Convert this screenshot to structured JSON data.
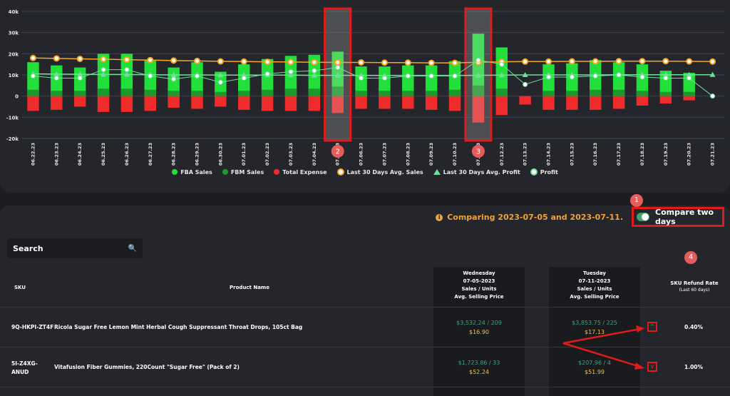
{
  "chart_data": {
    "type": "bar",
    "categories": [
      "06.22.23",
      "06.23.23",
      "06.24.23",
      "06.25.23",
      "06.26.23",
      "06.27.23",
      "06.28.23",
      "06.29.23",
      "06.30.23",
      "07.01.23",
      "07.02.23",
      "07.03.23",
      "07.04.23",
      "07.05.23",
      "07.06.23",
      "07.07.23",
      "07.08.23",
      "07.09.23",
      "07.10.23",
      "07.11.23",
      "07.12.23",
      "07.13.23",
      "07.14.23",
      "07.15.23",
      "07.16.23",
      "07.17.23",
      "07.18.23",
      "07.19.23",
      "07.20.23",
      "07.21.23"
    ],
    "ylim": [
      -20000,
      40000
    ],
    "yticks": [
      "-20k",
      "-10k",
      "0",
      "10k",
      "20k",
      "30k",
      "40k"
    ],
    "series": [
      {
        "name": "FBA Sales",
        "color": "#22e03a",
        "values": [
          16000,
          14500,
          13500,
          20000,
          20000,
          17000,
          13500,
          16000,
          11500,
          15000,
          17500,
          19000,
          19500,
          21000,
          14000,
          14000,
          14500,
          14500,
          16500,
          29500,
          23000,
          0,
          15000,
          15500,
          17000,
          16000,
          15000,
          12000,
          11000,
          0
        ]
      },
      {
        "name": "FBM Sales",
        "color": "#1a9a2a",
        "values": [
          3000,
          2500,
          2500,
          3500,
          3500,
          3000,
          2500,
          2500,
          2000,
          2500,
          3000,
          3500,
          3500,
          4500,
          2500,
          2500,
          2500,
          2500,
          3000,
          5000,
          3500,
          0,
          2500,
          2500,
          3000,
          3000,
          2500,
          2000,
          2000,
          0
        ]
      },
      {
        "name": "Total Expense",
        "color": "#ef2b2b",
        "values": [
          -7000,
          -6500,
          -5000,
          -7500,
          -7500,
          -7000,
          -5500,
          -6000,
          -5000,
          -6500,
          -7000,
          -7000,
          -7000,
          -8000,
          -6000,
          -6000,
          -6000,
          -6500,
          -7000,
          -12500,
          -9000,
          -4000,
          -6500,
          -6500,
          -6500,
          -6000,
          -4500,
          -3500,
          -2000,
          0
        ]
      },
      {
        "name": "Last 30 Days Avg. Sales",
        "color": "#f5a623",
        "values": [
          18000,
          17800,
          17600,
          17400,
          17200,
          17000,
          16800,
          16600,
          16400,
          16300,
          16200,
          16100,
          16000,
          15900,
          15900,
          15800,
          15800,
          15700,
          15700,
          16000,
          16200,
          16300,
          16300,
          16400,
          16400,
          16500,
          16500,
          16500,
          16400,
          16300
        ]
      },
      {
        "name": "Last 30 Days Avg. Profit",
        "color": "#6fe09a",
        "values": [
          10500,
          10400,
          10300,
          10200,
          10200,
          10100,
          10000,
          10000,
          9900,
          9900,
          9900,
          9900,
          9800,
          9800,
          9800,
          9700,
          9700,
          9700,
          9700,
          9800,
          9900,
          10000,
          10000,
          10000,
          10000,
          10100,
          10100,
          10100,
          10100,
          10100
        ]
      },
      {
        "name": "Profit",
        "color": "#ffffff",
        "values": [
          9500,
          8500,
          8500,
          12500,
          12500,
          9500,
          8000,
          9500,
          6500,
          8500,
          10500,
          11500,
          12000,
          13500,
          8500,
          8500,
          9500,
          9500,
          9500,
          17000,
          15000,
          5500,
          9000,
          9000,
          9500,
          10000,
          9000,
          8500,
          8500,
          0
        ]
      }
    ]
  },
  "legend": [
    "FBA Sales",
    "FBM Sales",
    "Total Expense",
    "Last 30 Days Avg. Sales",
    "Last 30 Days Avg. Profit",
    "Profit"
  ],
  "badges": [
    "1",
    "2",
    "3",
    "4"
  ],
  "compare": {
    "info": "Comparing 2023-07-05 and 2023-07-11.",
    "label": "Compare two days",
    "icon": "i"
  },
  "search": {
    "label": "Search",
    "icon": "🔍"
  },
  "table": {
    "headers": {
      "sku": "SKU",
      "product": "Product Name",
      "day1": [
        "Wednesday",
        "07-05-2023",
        "Sales / Units",
        "Avg. Selling Price"
      ],
      "day2": [
        "Tuesday",
        "07-11-2023",
        "Sales / Units",
        "Avg. Selling Price"
      ],
      "refund": [
        "SKU Refund Rate",
        "(Last 60 days)"
      ]
    },
    "rows": [
      {
        "sku": "9Q-HKPI-ZT4F",
        "product": "Ricola Sugar Free Lemon Mint Herbal Cough Suppressant Throat Drops, 105ct Bag",
        "d1_sales": "$3,532.24 / 209",
        "d1_price": "$16.90",
        "d2_sales": "$3,853.75 / 225",
        "d2_price": "$17.13",
        "trend": "up",
        "trend_icon": "^",
        "refund": "0.40%"
      },
      {
        "sku": "5I-Z4XG-ANUD",
        "product": "Vitafusion Fiber Gummies, 220Count \"Sugar Free\" (Pack of 2)",
        "d1_sales": "$1,723.86 / 33",
        "d1_price": "$52.24",
        "d2_sales": "$207.96 / 4",
        "d2_price": "$51.99",
        "trend": "down",
        "trend_icon": "v",
        "refund": "1.00%"
      }
    ]
  }
}
